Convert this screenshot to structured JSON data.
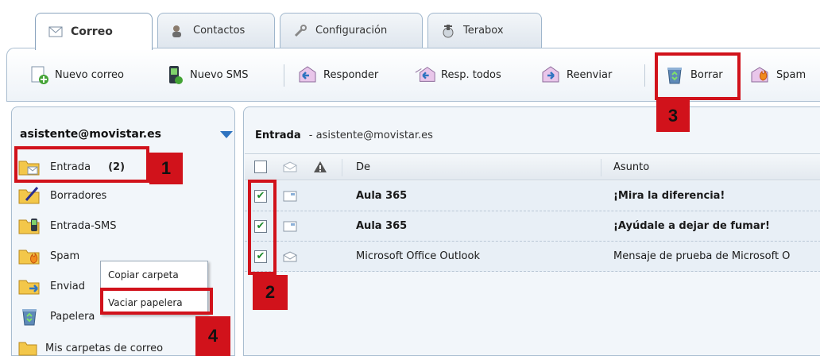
{
  "tabs": [
    {
      "label": "Correo",
      "icon": "envelope-icon"
    },
    {
      "label": "Contactos",
      "icon": "contacts-icon"
    },
    {
      "label": "Configuración",
      "icon": "wrench-icon"
    },
    {
      "label": "Terabox",
      "icon": "terabox-icon"
    }
  ],
  "toolbar": {
    "new_mail": "Nuevo correo",
    "new_sms": "Nuevo SMS",
    "reply": "Responder",
    "reply_all": "Resp. todos",
    "forward": "Reenviar",
    "delete": "Borrar",
    "spam": "Spam"
  },
  "sidebar": {
    "account": "asistente@movistar.es",
    "folders": [
      {
        "label": "Entrada",
        "count": "(2)",
        "icon": "inbox-folder-icon"
      },
      {
        "label": "Borradores",
        "icon": "drafts-folder-icon"
      },
      {
        "label": "Entrada-SMS",
        "icon": "sms-folder-icon"
      },
      {
        "label": "Spam",
        "icon": "spam-folder-icon"
      },
      {
        "label": "Enviad",
        "icon": "sent-folder-icon"
      },
      {
        "label": "Papelera",
        "icon": "trash-folder-icon"
      },
      {
        "label": "Mis carpetas de correo",
        "icon": "my-folders-icon"
      }
    ]
  },
  "context_menu": {
    "items": [
      "Copiar carpeta",
      "Vaciar papelera"
    ]
  },
  "main": {
    "folder_title": "Entrada",
    "folder_subtitle": "- asistente@movistar.es",
    "columns": {
      "from": "De",
      "subject": "Asunto"
    },
    "rows": [
      {
        "checked": true,
        "from": "Aula 365",
        "subject": "¡Mira la diferencia!",
        "unread": true
      },
      {
        "checked": true,
        "from": "Aula 365",
        "subject": "¡Ayúdale a dejar de fumar!",
        "unread": true
      },
      {
        "checked": true,
        "from": "Microsoft Office Outlook",
        "subject": "Mensaje de prueba de Microsoft O",
        "unread": false
      }
    ]
  },
  "annotations": [
    "1",
    "2",
    "3",
    "4"
  ],
  "colors": {
    "highlight": "#d1121b",
    "accent": "#2f74c0",
    "panel_bg": "#f2f6fa",
    "row_bg": "#e8eff6"
  }
}
